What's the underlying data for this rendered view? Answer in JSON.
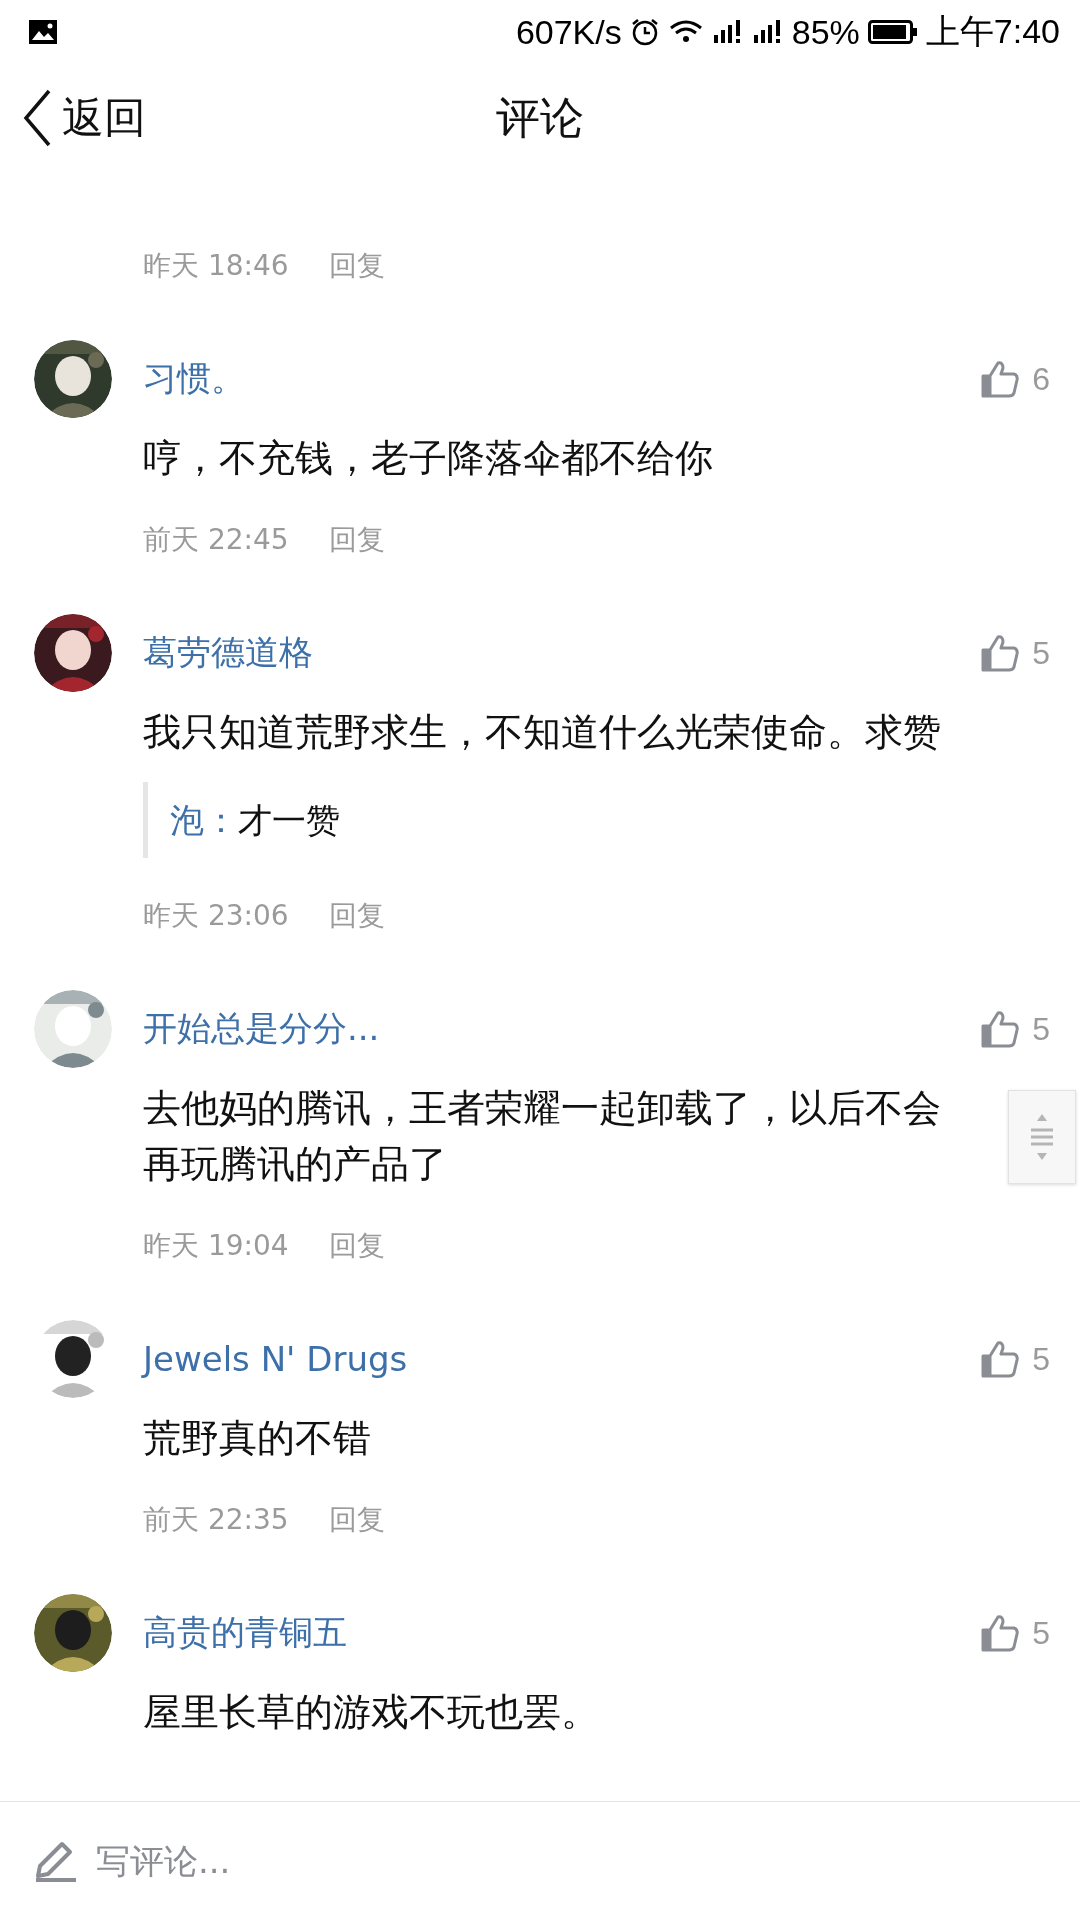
{
  "status_bar": {
    "speed": "607K/s",
    "battery": "85%",
    "time": "上午7:40"
  },
  "header": {
    "back": "返回",
    "title": "评论"
  },
  "top_meta": {
    "time": "昨天 18:46",
    "reply_label": "回复"
  },
  "comments": [
    {
      "name": "习惯。",
      "likes": "6",
      "text": "哼，不充钱，老子降落伞都不给你",
      "time": "前天 22:45",
      "reply_label": "回复"
    },
    {
      "name": "葛劳德道格",
      "likes": "5",
      "text": "我只知道荒野求生，不知道什么光荣使命。求赞",
      "reply": {
        "author": "泡：",
        "text": "才一赞"
      },
      "time": "昨天 23:06",
      "reply_label": "回复"
    },
    {
      "name": "开始总是分分...",
      "likes": "5",
      "text": "去他妈的腾讯，王者荣耀一起卸载了，以后不会再玩腾讯的产品了",
      "time": "昨天 19:04",
      "reply_label": "回复"
    },
    {
      "name": "Jewels N' Drugs",
      "likes": "5",
      "text": "荒野真的不错",
      "time": "前天 22:35",
      "reply_label": "回复"
    },
    {
      "name": "高贵的青铜五",
      "likes": "5",
      "text": "屋里长草的游戏不玩也罢。"
    }
  ],
  "comment_input": {
    "placeholder": "写评论..."
  }
}
